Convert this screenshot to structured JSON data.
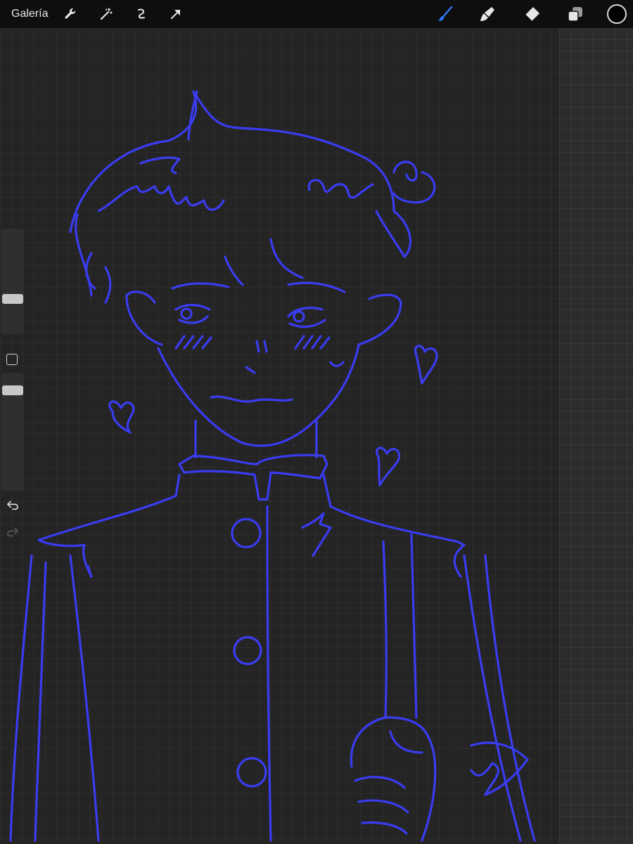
{
  "toolbar": {
    "gallery_label": "Galería",
    "left_tools": [
      "wrench-icon",
      "magic-wand-icon",
      "selection-icon",
      "transform-arrow-icon"
    ],
    "right_tools": [
      "brush-icon",
      "smudge-icon",
      "eraser-icon",
      "layers-icon"
    ],
    "active_tool": "brush",
    "active_tool_color": "#2f7bff",
    "current_color": "#000000"
  },
  "sidebar": {
    "brush_size_level": 0.5,
    "opacity_level": 0.78
  },
  "canvas": {
    "background": "#242424",
    "stroke_color": "#3a3cf0"
  }
}
